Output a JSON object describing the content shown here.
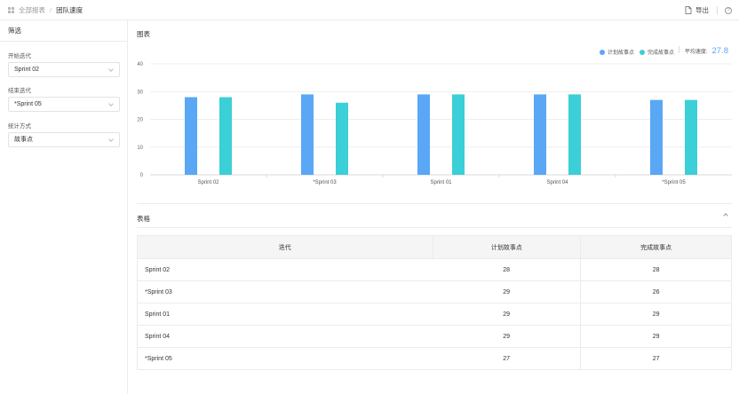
{
  "breadcrumb": {
    "root": "全部报表",
    "separator": "/",
    "current": "团队速度"
  },
  "toolbar": {
    "export_label": "导出",
    "help_label": "?"
  },
  "sidebar": {
    "title": "筛选",
    "filters": [
      {
        "label": "开始迭代",
        "value": "Sprint 02"
      },
      {
        "label": "结束迭代",
        "value": "*Sprint 05"
      },
      {
        "label": "统计方式",
        "value": "故事点"
      }
    ]
  },
  "chart_section": {
    "title": "图表",
    "legend": [
      {
        "name": "计划故事点",
        "color": "#5aa7f5"
      },
      {
        "name": "完成故事点",
        "color": "#3bcfd7"
      }
    ],
    "average": {
      "label": "平均速度:",
      "value": "27.8"
    }
  },
  "chart_data": {
    "type": "bar",
    "categories": [
      "Sprint 02",
      "*Sprint 03",
      "Sprint 01",
      "Sprint 04",
      "*Sprint 05"
    ],
    "series": [
      {
        "name": "计划故事点",
        "values": [
          28,
          29,
          29,
          29,
          27
        ],
        "color": "#5aa7f5"
      },
      {
        "name": "完成故事点",
        "values": [
          28,
          26,
          29,
          29,
          27
        ],
        "color": "#3bcfd7"
      }
    ],
    "ylim": [
      0,
      40
    ],
    "yticks": [
      0,
      10,
      20,
      30,
      40
    ],
    "grid": true,
    "legend_position": "top-right"
  },
  "table_section": {
    "title": "表格",
    "headers": [
      "迭代",
      "计划故事点",
      "完成故事点"
    ],
    "rows": [
      [
        "Sprint 02",
        "28",
        "28"
      ],
      [
        "*Sprint 03",
        "29",
        "26"
      ],
      [
        "Sprint 01",
        "29",
        "29"
      ],
      [
        "Sprint 04",
        "29",
        "29"
      ],
      [
        "*Sprint 05",
        "27",
        "27"
      ]
    ]
  }
}
